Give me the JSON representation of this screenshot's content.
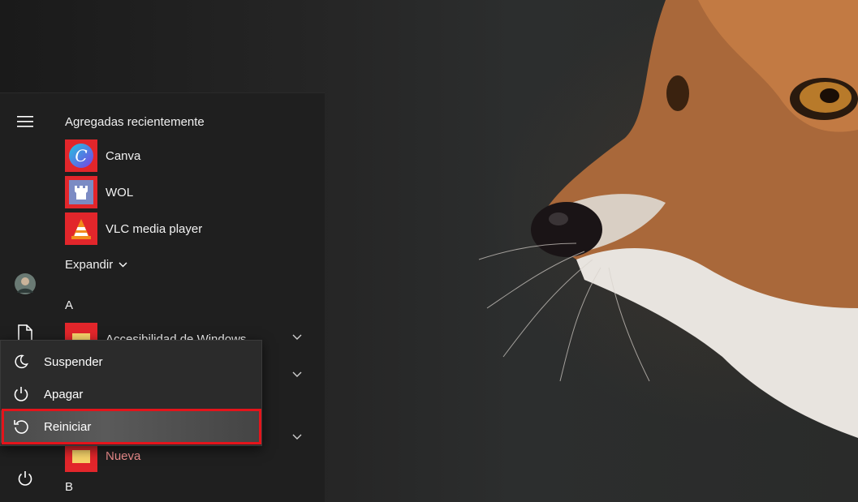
{
  "start_menu": {
    "recent_title": "Agregadas recientemente",
    "recent_apps": [
      {
        "label": "Canva",
        "icon": "canva-icon"
      },
      {
        "label": "WOL",
        "icon": "wol-icon"
      },
      {
        "label": "VLC media player",
        "icon": "vlc-icon"
      }
    ],
    "expand_label": "Expandir",
    "letters": [
      "A",
      "B"
    ],
    "apps_a": [
      {
        "label": "Accesibilidad de Windows",
        "icon": "folder-icon"
      }
    ],
    "new_app": {
      "label": "Nueva",
      "icon": "folder-icon"
    }
  },
  "power_menu": {
    "items": [
      {
        "label": "Suspender",
        "icon": "moon-icon"
      },
      {
        "label": "Apagar",
        "icon": "power-icon"
      },
      {
        "label": "Reiniciar",
        "icon": "restart-icon"
      }
    ],
    "highlighted": "Reiniciar"
  },
  "colors": {
    "app_tile_bg": "#e2262b",
    "highlight_border": "#e4141b",
    "menu_bg": "#1f1f1f",
    "flyout_bg": "#2b2b2b"
  }
}
